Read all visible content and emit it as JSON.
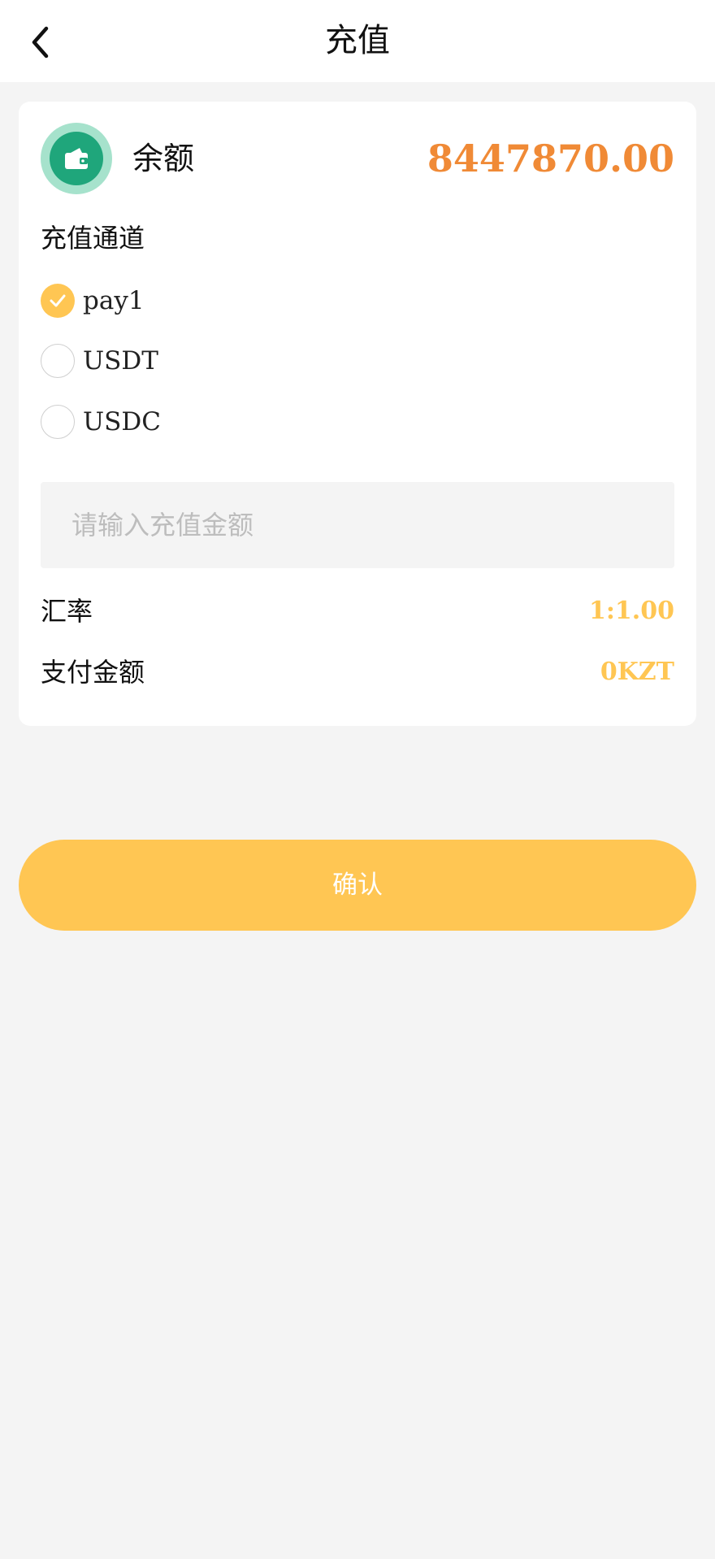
{
  "header": {
    "title": "充值",
    "back_icon": "chevron-left-icon"
  },
  "balance": {
    "icon": "wallet-icon",
    "label": "余额",
    "value": "8447870.00",
    "value_color": "#f08a36"
  },
  "channels": {
    "title": "充值通道",
    "options": [
      {
        "label": "pay1",
        "selected": true
      },
      {
        "label": "USDT",
        "selected": false
      },
      {
        "label": "USDC",
        "selected": false
      }
    ]
  },
  "amount_input": {
    "placeholder": "请输入充值金额",
    "value": ""
  },
  "exchange_rate": {
    "label": "汇率",
    "value": "1:1.00"
  },
  "pay_amount": {
    "label": "支付金额",
    "value": "0KZT"
  },
  "confirm": {
    "label": "确认"
  },
  "colors": {
    "accent": "#ffc653",
    "balance": "#f08a36",
    "wallet_outer": "#a6e2cc",
    "wallet_inner": "#1fa67b"
  }
}
